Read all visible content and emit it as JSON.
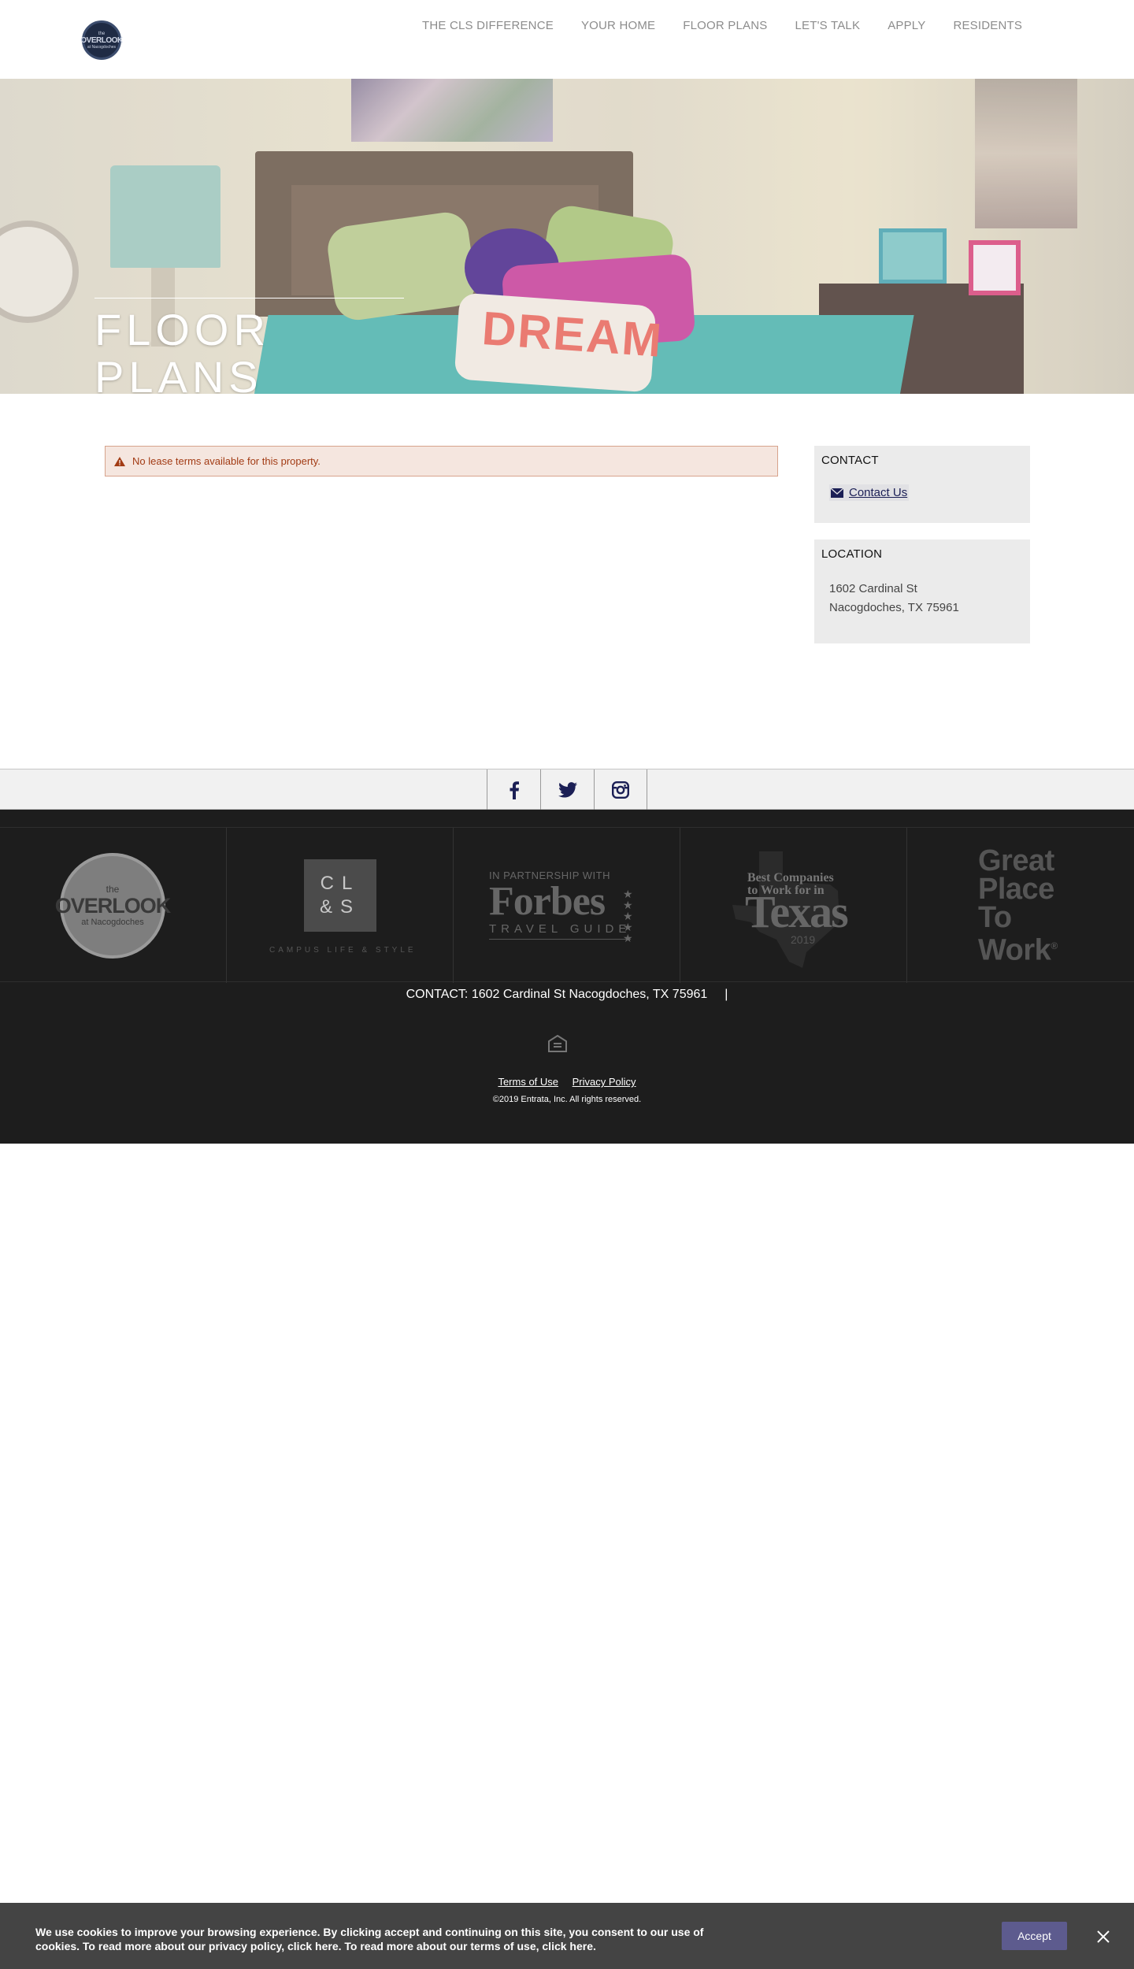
{
  "header": {
    "logo": {
      "line1": "the",
      "line2": "OVERLOOK",
      "line3": "at Nacogdoches",
      "icon": "overlook-logo"
    },
    "nav": [
      {
        "label": "THE CLS DIFFERENCE"
      },
      {
        "label": "YOUR HOME"
      },
      {
        "label": "FLOOR PLANS"
      },
      {
        "label": "LET'S TALK"
      },
      {
        "label": "APPLY"
      },
      {
        "label": "RESIDENTS"
      }
    ]
  },
  "hero": {
    "title": "FLOOR PLANS",
    "pillow_text": "DREAM"
  },
  "alert": {
    "icon": "warning-icon",
    "text": "No lease terms available for this property.",
    "color": "#a23b14"
  },
  "sidebar": {
    "contact": {
      "title": "CONTACT",
      "link_label": "Contact Us",
      "icon": "mail-icon"
    },
    "location": {
      "title": "LOCATION",
      "address_line1": "1602 Cardinal St",
      "address_line2": "Nacogdoches, TX 75961"
    }
  },
  "social": [
    {
      "name": "facebook",
      "icon": "facebook-icon"
    },
    {
      "name": "twitter",
      "icon": "twitter-icon"
    },
    {
      "name": "instagram",
      "icon": "instagram-icon"
    }
  ],
  "footer": {
    "partners": {
      "overlook": {
        "line1": "the",
        "line2": "OVERLOOK",
        "line3": "at Nacogdoches"
      },
      "cls": {
        "row1": "CL",
        "row2": "&S",
        "sub": "CAMPUS LIFE & STYLE"
      },
      "forbes": {
        "line1": "IN PARTNERSHIP WITH",
        "line2": "Forbes",
        "line3": "TRAVEL GUIDE"
      },
      "texas": {
        "line1": "Best Companies",
        "line2": "to Work for in",
        "line3": "Texas",
        "year": "2019"
      },
      "gptw": {
        "line1": "Great",
        "line2": "Place",
        "line3": "To",
        "line4": "Work",
        "mark": "®"
      }
    },
    "contact_text": "CONTACT: 1602 Cardinal St Nacogdoches, TX 75961",
    "contact_sep": "|",
    "eho_icon": "equal-housing-icon",
    "links": {
      "terms": "Terms of Use",
      "privacy": "Privacy Policy"
    },
    "copyright": "©2019 Entrata, Inc. All rights reserved."
  },
  "cookie": {
    "text_line1": "We use cookies to improve your browsing experience. By clicking accept and continuing on this site, you consent to our use of",
    "text_line2": "cookies. To read more about our privacy policy, click here. To read more about our terms of use, click here.",
    "accept_label": "Accept",
    "close_icon": "close-icon",
    "accent": "#5d5b8e"
  }
}
